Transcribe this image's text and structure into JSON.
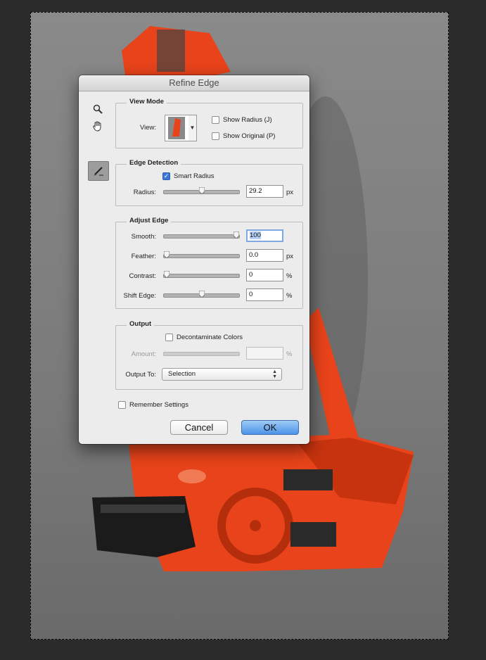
{
  "dialog": {
    "title": "Refine Edge",
    "view_mode": {
      "title": "View Mode",
      "view_label": "View:",
      "show_radius_label": "Show Radius (J)",
      "show_radius_checked": false,
      "show_original_label": "Show Original (P)",
      "show_original_checked": false
    },
    "edge_detection": {
      "title": "Edge Detection",
      "smart_radius_label": "Smart Radius",
      "smart_radius_checked": true,
      "radius_label": "Radius:",
      "radius_value": "29.2",
      "radius_unit": "px",
      "radius_level": 0.5
    },
    "adjust_edge": {
      "title": "Adjust Edge",
      "smooth_label": "Smooth:",
      "smooth_value": "100",
      "smooth_level": 1.0,
      "feather_label": "Feather:",
      "feather_value": "0.0",
      "feather_unit": "px",
      "feather_level": 0.0,
      "contrast_label": "Contrast:",
      "contrast_value": "0",
      "contrast_unit": "%",
      "contrast_level": 0.0,
      "shift_edge_label": "Shift Edge:",
      "shift_edge_value": "0",
      "shift_edge_unit": "%",
      "shift_edge_level": 0.5
    },
    "output": {
      "title": "Output",
      "decontaminate_label": "Decontaminate Colors",
      "decontaminate_checked": false,
      "amount_label": "Amount:",
      "amount_value": "",
      "amount_unit": "%",
      "output_to_label": "Output To:",
      "output_to_value": "Selection"
    },
    "remember_settings_label": "Remember Settings",
    "remember_settings_checked": false,
    "cancel_label": "Cancel",
    "ok_label": "OK"
  },
  "tools": [
    "zoom-icon",
    "hand-icon",
    "refine-radius-brush-icon"
  ],
  "colors": {
    "subject": "#e8431a",
    "accent": "#4b93e8"
  }
}
